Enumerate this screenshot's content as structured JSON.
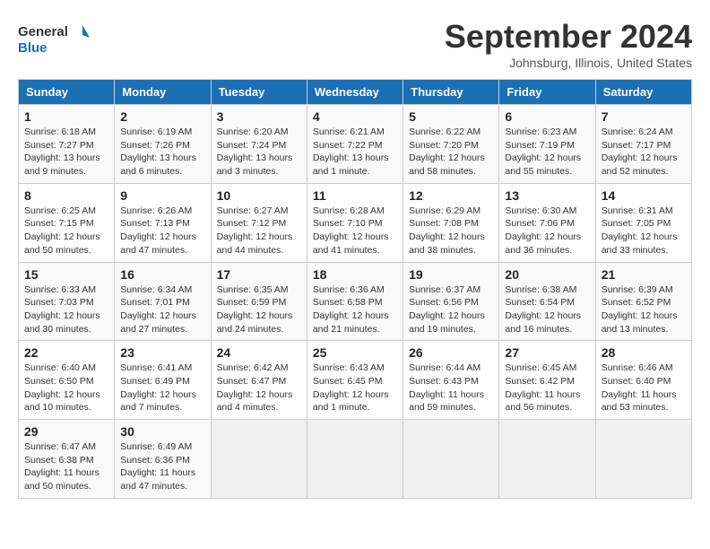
{
  "logo": {
    "text_general": "General",
    "text_blue": "Blue"
  },
  "title": "September 2024",
  "subtitle": "Johnsburg, Illinois, United States",
  "days_of_week": [
    "Sunday",
    "Monday",
    "Tuesday",
    "Wednesday",
    "Thursday",
    "Friday",
    "Saturday"
  ],
  "weeks": [
    [
      {
        "day": "1",
        "sunrise": "6:18 AM",
        "sunset": "7:27 PM",
        "daylight": "13 hours and 9 minutes."
      },
      {
        "day": "2",
        "sunrise": "6:19 AM",
        "sunset": "7:26 PM",
        "daylight": "13 hours and 6 minutes."
      },
      {
        "day": "3",
        "sunrise": "6:20 AM",
        "sunset": "7:24 PM",
        "daylight": "13 hours and 3 minutes."
      },
      {
        "day": "4",
        "sunrise": "6:21 AM",
        "sunset": "7:22 PM",
        "daylight": "13 hours and 1 minute."
      },
      {
        "day": "5",
        "sunrise": "6:22 AM",
        "sunset": "7:20 PM",
        "daylight": "12 hours and 58 minutes."
      },
      {
        "day": "6",
        "sunrise": "6:23 AM",
        "sunset": "7:19 PM",
        "daylight": "12 hours and 55 minutes."
      },
      {
        "day": "7",
        "sunrise": "6:24 AM",
        "sunset": "7:17 PM",
        "daylight": "12 hours and 52 minutes."
      }
    ],
    [
      {
        "day": "8",
        "sunrise": "6:25 AM",
        "sunset": "7:15 PM",
        "daylight": "12 hours and 50 minutes."
      },
      {
        "day": "9",
        "sunrise": "6:26 AM",
        "sunset": "7:13 PM",
        "daylight": "12 hours and 47 minutes."
      },
      {
        "day": "10",
        "sunrise": "6:27 AM",
        "sunset": "7:12 PM",
        "daylight": "12 hours and 44 minutes."
      },
      {
        "day": "11",
        "sunrise": "6:28 AM",
        "sunset": "7:10 PM",
        "daylight": "12 hours and 41 minutes."
      },
      {
        "day": "12",
        "sunrise": "6:29 AM",
        "sunset": "7:08 PM",
        "daylight": "12 hours and 38 minutes."
      },
      {
        "day": "13",
        "sunrise": "6:30 AM",
        "sunset": "7:06 PM",
        "daylight": "12 hours and 36 minutes."
      },
      {
        "day": "14",
        "sunrise": "6:31 AM",
        "sunset": "7:05 PM",
        "daylight": "12 hours and 33 minutes."
      }
    ],
    [
      {
        "day": "15",
        "sunrise": "6:33 AM",
        "sunset": "7:03 PM",
        "daylight": "12 hours and 30 minutes."
      },
      {
        "day": "16",
        "sunrise": "6:34 AM",
        "sunset": "7:01 PM",
        "daylight": "12 hours and 27 minutes."
      },
      {
        "day": "17",
        "sunrise": "6:35 AM",
        "sunset": "6:59 PM",
        "daylight": "12 hours and 24 minutes."
      },
      {
        "day": "18",
        "sunrise": "6:36 AM",
        "sunset": "6:58 PM",
        "daylight": "12 hours and 21 minutes."
      },
      {
        "day": "19",
        "sunrise": "6:37 AM",
        "sunset": "6:56 PM",
        "daylight": "12 hours and 19 minutes."
      },
      {
        "day": "20",
        "sunrise": "6:38 AM",
        "sunset": "6:54 PM",
        "daylight": "12 hours and 16 minutes."
      },
      {
        "day": "21",
        "sunrise": "6:39 AM",
        "sunset": "6:52 PM",
        "daylight": "12 hours and 13 minutes."
      }
    ],
    [
      {
        "day": "22",
        "sunrise": "6:40 AM",
        "sunset": "6:50 PM",
        "daylight": "12 hours and 10 minutes."
      },
      {
        "day": "23",
        "sunrise": "6:41 AM",
        "sunset": "6:49 PM",
        "daylight": "12 hours and 7 minutes."
      },
      {
        "day": "24",
        "sunrise": "6:42 AM",
        "sunset": "6:47 PM",
        "daylight": "12 hours and 4 minutes."
      },
      {
        "day": "25",
        "sunrise": "6:43 AM",
        "sunset": "6:45 PM",
        "daylight": "12 hours and 1 minute."
      },
      {
        "day": "26",
        "sunrise": "6:44 AM",
        "sunset": "6:43 PM",
        "daylight": "11 hours and 59 minutes."
      },
      {
        "day": "27",
        "sunrise": "6:45 AM",
        "sunset": "6:42 PM",
        "daylight": "11 hours and 56 minutes."
      },
      {
        "day": "28",
        "sunrise": "6:46 AM",
        "sunset": "6:40 PM",
        "daylight": "11 hours and 53 minutes."
      }
    ],
    [
      {
        "day": "29",
        "sunrise": "6:47 AM",
        "sunset": "6:38 PM",
        "daylight": "11 hours and 50 minutes."
      },
      {
        "day": "30",
        "sunrise": "6:49 AM",
        "sunset": "6:36 PM",
        "daylight": "11 hours and 47 minutes."
      },
      null,
      null,
      null,
      null,
      null
    ]
  ]
}
